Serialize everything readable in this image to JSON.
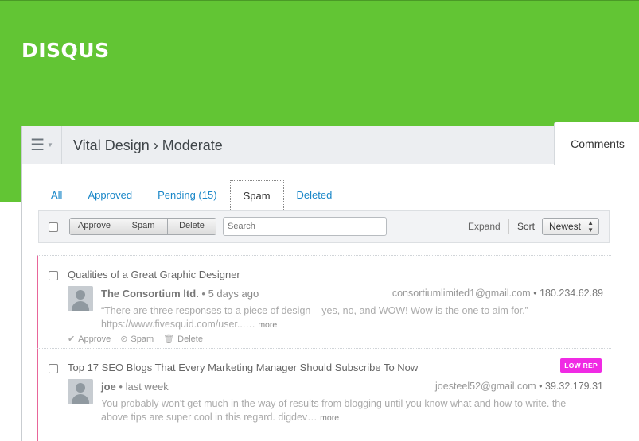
{
  "brand": {
    "logo": "DISQUS",
    "accent": "#62c534"
  },
  "header": {
    "menu_icon": "hamburger-icon",
    "breadcrumb": "Vital Design › Moderate",
    "tab": "Comments"
  },
  "filters": {
    "tabs": [
      "All",
      "Approved",
      "Pending (15)",
      "Spam",
      "Deleted"
    ],
    "active": "Spam"
  },
  "toolbar": {
    "approve_label": "Approve",
    "spam_label": "Spam",
    "delete_label": "Delete",
    "search_placeholder": "Search",
    "expand_label": "Expand",
    "sort_label": "Sort",
    "sort_value": "Newest"
  },
  "comments": [
    {
      "title": "Qualities of a Great Graphic Designer",
      "author": "The Consortium ltd.",
      "time": "• 5 days ago",
      "email": "consortiumlimited1@gmail.com",
      "ip": "• 180.234.62.89",
      "text_line1": "“There are three responses to a piece of design – yes, no, and WOW! Wow is the one to aim for.”",
      "text_line2": "https://www.fivesquid.com/user...…",
      "more": "more",
      "actions": {
        "approve": "Approve",
        "spam": "Spam",
        "delete": "Delete"
      }
    },
    {
      "title": "Top 17 SEO Blogs That Every Marketing Manager Should Subscribe To Now",
      "badge": "LOW REP",
      "badge_color": "#f02ae4",
      "author": "joe",
      "time": "• last week",
      "email": "joesteel52@gmail.com",
      "ip": "• 39.32.179.31",
      "text_line1": "You probably won't get much in the way of results from blogging until you know what and how to write. the",
      "text_line2": "above tips are super cool in this regard. digdev…",
      "more": "more"
    }
  ],
  "colors": {
    "spam_marker": "#e8669a",
    "link": "#1a87c8"
  }
}
